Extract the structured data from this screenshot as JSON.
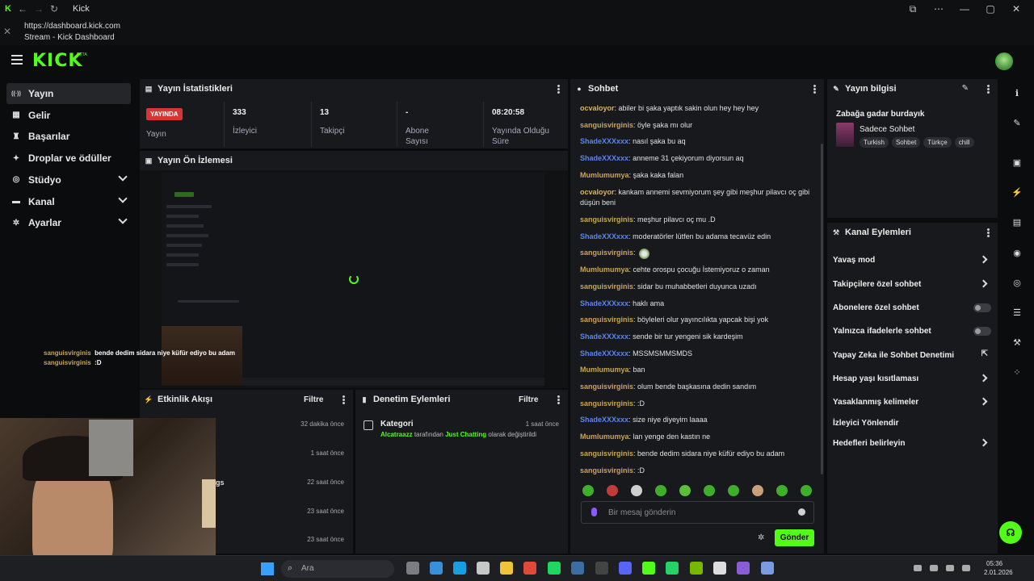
{
  "window": {
    "title": "Kick",
    "url": "https://dashboard.kick.com",
    "page_title": "Stream - Kick Dashboard"
  },
  "app": {
    "logo": "KICK",
    "logo_sup": "BETA"
  },
  "sidebar": {
    "items": [
      {
        "label": "Yayın",
        "icon": "broadcast-icon",
        "active": true,
        "expandable": false
      },
      {
        "label": "Gelir",
        "icon": "wallet-icon",
        "active": false,
        "expandable": false
      },
      {
        "label": "Başarılar",
        "icon": "trophy-icon",
        "active": false,
        "expandable": false
      },
      {
        "label": "Droplar ve ödüller",
        "icon": "gift-icon",
        "active": false,
        "expandable": false
      },
      {
        "label": "Stüdyo",
        "icon": "studio-icon",
        "active": false,
        "expandable": true
      },
      {
        "label": "Kanal",
        "icon": "channel-icon",
        "active": false,
        "expandable": true
      },
      {
        "label": "Ayarlar",
        "icon": "gear-icon",
        "active": false,
        "expandable": true
      }
    ]
  },
  "stats_panel": {
    "title": "Yayın İstatistikleri",
    "live_badge": "YAYINDA",
    "items": [
      {
        "value": "",
        "label": "Yayın"
      },
      {
        "value": "333",
        "label": "İzleyici"
      },
      {
        "value": "13",
        "label": "Takipçi"
      },
      {
        "value": "-",
        "label": "Abone Sayısı"
      },
      {
        "value": "08:20:58",
        "label": "Yayında Olduğu Süre"
      }
    ]
  },
  "preview_panel": {
    "title": "Yayın Ön İzlemesi"
  },
  "overlay_chat": [
    {
      "user": "sanguisvirginis",
      "text": "bende dedim sidara niye küfür ediyo bu adam"
    },
    {
      "user": "sanguisvirginis",
      "text": ":D"
    }
  ],
  "activity_panel": {
    "title": "Etkinlik Akışı",
    "filter_label": "Filtre",
    "items": [
      {
        "text": "",
        "time": "32 dakika önce"
      },
      {
        "text": "",
        "time": "1 saat önce"
      },
      {
        "text": "gs",
        "time": "22 saat önce"
      },
      {
        "text": "",
        "time": "23 saat önce"
      },
      {
        "text": "",
        "time": "23 saat önce"
      }
    ]
  },
  "moderation_panel": {
    "title": "Denetim Eylemleri",
    "filter_label": "Filtre",
    "items": [
      {
        "title": "Kategori",
        "time": "1 saat önce",
        "actor": "Alcatraazz",
        "middle": "tarafından",
        "category": "Just Chatting",
        "suffix": "olarak değiştirildi"
      }
    ]
  },
  "chat_panel": {
    "title": "Sohbet",
    "messages": [
      {
        "user": "ocvaloyor",
        "color": "ocva",
        "text": "abiler bi şaka yaptık sakin olun hey hey hey"
      },
      {
        "user": "sanguisvirginis",
        "color": "sang",
        "text": "öyle şaka mı olur"
      },
      {
        "user": "ShadeXXXxxx",
        "color": "shade",
        "text": "nasıl şaka bu aq"
      },
      {
        "user": "ShadeXXXxxx",
        "color": "shade",
        "text": "anneme 31 çekiyorum diyorsun aq"
      },
      {
        "user": "Mumlumumya",
        "color": "mumu",
        "text": "şaka kaka falan"
      },
      {
        "user": "ocvaloyor",
        "color": "ocva",
        "text": "kankam annemi sevmiyorum şey gibi meşhur pilavcı oç gibi düşün beni"
      },
      {
        "user": "sanguisvirginis",
        "color": "sang",
        "text": "meşhur pilavcı oç mu .D"
      },
      {
        "user": "ShadeXXXxxx",
        "color": "shade",
        "text": "moderatörler lütfen bu adama tecavüz edin"
      },
      {
        "user": "sanguisvirginis",
        "color": "sang",
        "text": ""
      },
      {
        "user": "Mumlumumya",
        "color": "mumu",
        "text": "cehte orospu çocuğu İstemiyoruz o zaman"
      },
      {
        "user": "sanguisvirginis",
        "color": "sang",
        "text": "sidar bu muhabbetleri duyunca uzadı"
      },
      {
        "user": "ShadeXXXxxx",
        "color": "shade",
        "text": "haklı ama"
      },
      {
        "user": "sanguisvirginis",
        "color": "sang",
        "text": "böyleleri olur yayıncılıkta yapcak bişi yok"
      },
      {
        "user": "ShadeXXXxxx",
        "color": "shade",
        "text": "sende bir tur yengeni sik kardeşim"
      },
      {
        "user": "ShadeXXXxxx",
        "color": "shade",
        "text": "MSSMSMMSMDS"
      },
      {
        "user": "Mumlumumya",
        "color": "mumu",
        "text": "ban"
      },
      {
        "user": "sanguisvirginis",
        "color": "sang",
        "text": "olum bende başkasına dedin sandım"
      },
      {
        "user": "sanguisvirginis",
        "color": "sang",
        "text": ":D"
      },
      {
        "user": "ShadeXXXxxx",
        "color": "shade",
        "text": "size niye diyeyim laaaa"
      },
      {
        "user": "Mumlumumya",
        "color": "mumu",
        "text": "lan yenge den kastın ne"
      },
      {
        "user": "sanguisvirginis",
        "color": "sang",
        "text": "bende dedim sidara niye küfür ediyo bu adam"
      },
      {
        "user": "sanguisvirginis",
        "color": "sang",
        "text": ":D"
      }
    ],
    "input_placeholder": "Bir mesaj gönderin",
    "send_label": "Gönder"
  },
  "stream_info_panel": {
    "title": "Yayın bilgisi",
    "stream_title": "Zabağa gadar burdayık",
    "category": "Sadece Sohbet",
    "tags": [
      "Turkish",
      "Sohbet",
      "Türkçe",
      "chill"
    ]
  },
  "channel_actions_panel": {
    "title": "Kanal Eylemleri",
    "items": [
      {
        "label": "Yavaş mod",
        "control": "chevron"
      },
      {
        "label": "Takipçilere özel sohbet",
        "control": "chevron"
      },
      {
        "label": "Abonelere özel sohbet",
        "control": "toggle"
      },
      {
        "label": "Yalnızca ifadelerle sohbet",
        "control": "toggle"
      },
      {
        "label": "Yapay Zeka ile Sohbet Denetimi",
        "control": "external"
      },
      {
        "label": "Hesap yaşı kısıtlaması",
        "control": "chevron"
      },
      {
        "label": "Yasaklanmış kelimeler",
        "control": "chevron"
      },
      {
        "label": "İzleyici Yönlendir",
        "control": "none"
      },
      {
        "label": "Hedefleri belirleyin",
        "control": "chevron"
      }
    ]
  },
  "taskbar": {
    "search_placeholder": "Ara",
    "time": "05:36",
    "date": "2.01.2026"
  },
  "colors": {
    "accent": "#53fc18",
    "live": "#d63636",
    "panel": "#18191c",
    "background": "#0b0c0e"
  }
}
